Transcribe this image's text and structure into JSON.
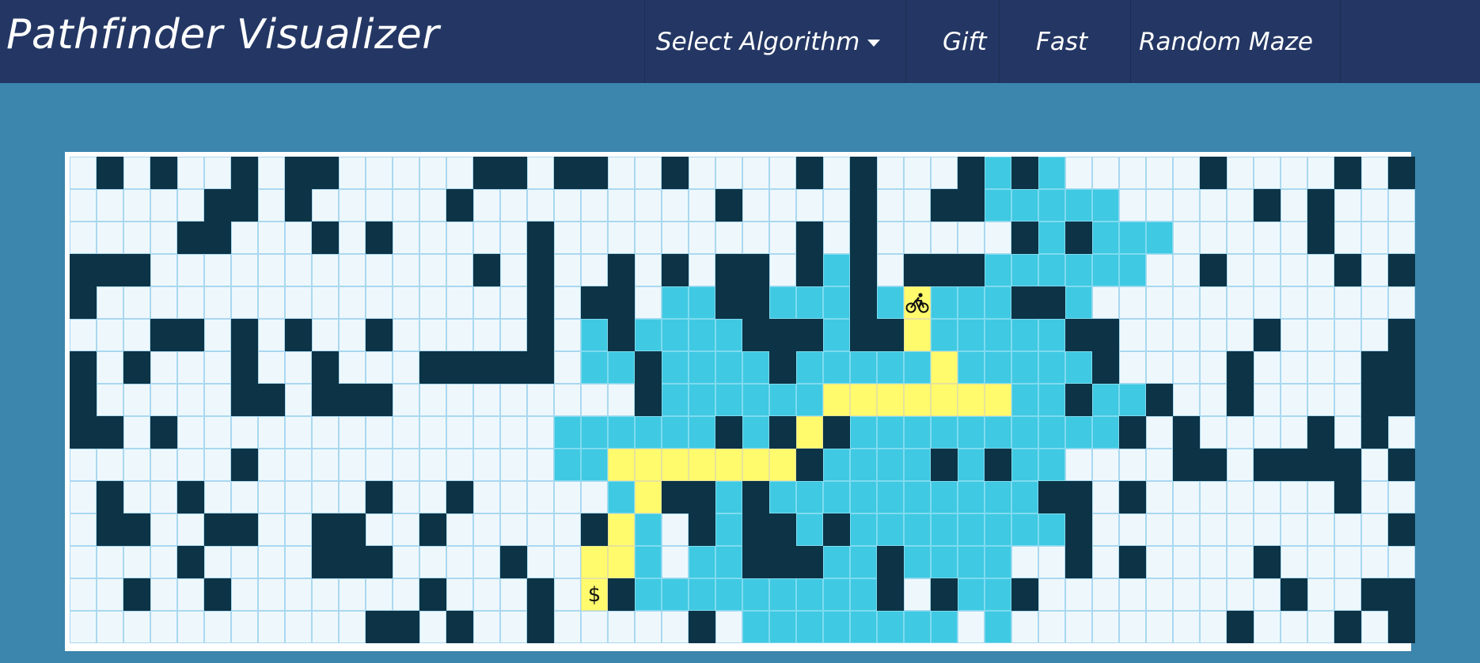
{
  "app": {
    "title": "Pathfinder Visualizer",
    "nav": {
      "select_algorithm": "Select Algorithm",
      "gift": "Gift",
      "fast": "Fast",
      "random_maze": "Random Maze"
    }
  },
  "colors": {
    "navbar": "#243764",
    "background": "#3c86ae",
    "wall": "#0c3446",
    "visited": "#40c9e2",
    "path": "#fffb6c",
    "unvisited": "#eef8fc"
  },
  "grid": {
    "rows": 15,
    "cols": 50,
    "legend": "# = wall, v = visited, p = shortest path, S = start (bike icon), T = target ($), . = unvisited",
    "cells": [
      ".#.#..#.##.....##.##..#....#.#...#v#v.....#....#.#",
      ".....##.#.....#.........#....#..##vvvvv.....#.#...",
      "....##...#.#.....#.........#.#.....#v#vvv.....#...",
      "###............#.#..#.#.##.#v#.###vvvvvv..#....#.#",
      "#................#.##.vv##vvv#vSvvv##v............",
      "...##.#.#..#.....#.v#vvvv###v##pvvvvv##.....#....#",
      "#.#...#..#...#####.vv#vvvv#vvvvvpvvvvv#....#....##",
      "#.....##.###.........#vvvvvvpppppppvv#vv#..#....##",
      "##.#..............vvvvvv#v#p#vvvvvvvvvv#.#....#.#.",
      "......#...........vvppppppp#vvvv#v#vv....##.####.#",
      ".#..#......#..#.....vp##v#vvvvvvvvvv##.#.......#..",
      ".##..##..##..#.....#pv.#v##v#vvvvvvvv#...........#",
      "....#....###....#..ppv.vv###vv#vvvv..#.#....#.....",
      "..#..#.......#...#.T#vvvvvvvvv#.#vv#.........#..##",
      "...........##.#..#.....#.vvvvvvvv.v........#...#.#"
    ]
  }
}
